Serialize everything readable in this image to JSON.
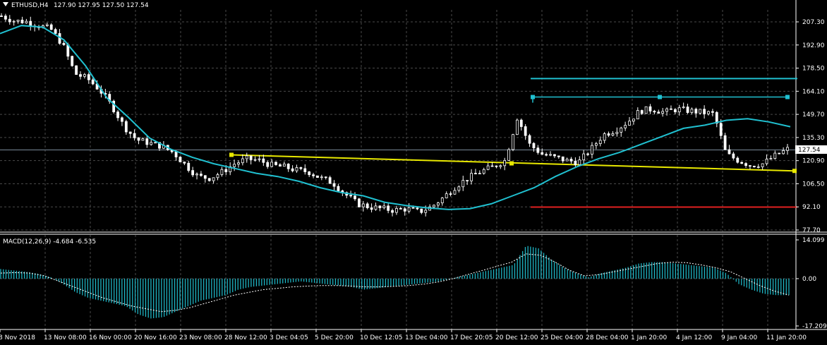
{
  "header": {
    "symbol": "ETHUSD,H4",
    "ohlc": "127.90 127.95 127.50 127.54"
  },
  "macd_header": {
    "label": "MACD(12,26,9) -4.684 -6.535"
  },
  "price_axis": {
    "ticks": [
      "207.30",
      "192.90",
      "178.50",
      "164.10",
      "149.70",
      "135.30",
      "120.90",
      "106.50",
      "92.10",
      "77.70"
    ],
    "current_price": "127.54"
  },
  "macd_axis": {
    "ticks": [
      "14.099",
      "0.00",
      "-17.209"
    ]
  },
  "time_axis": {
    "labels": [
      "8 Nov 2018",
      "13 Nov 08:00",
      "16 Nov 00:00",
      "20 Nov 16:00",
      "23 Nov 08:00",
      "28 Nov 12:00",
      "3 Dec 04:05",
      "5 Dec 20:00",
      "10 Dec 12:05",
      "13 Dec 04:00",
      "17 Dec 20:05",
      "20 Dec 12:00",
      "25 Dec 04:00",
      "28 Dec 04:00",
      "1 Jan 20:00",
      "4 Jan 12:00",
      "9 Jan 04:00",
      "11 Jan 20:00"
    ]
  },
  "colors": {
    "background": "#000000",
    "grid": "#4a4a4a",
    "candle": "#ffffff",
    "ma": "#20c0d0",
    "trendline": "#e8e800",
    "resistance": "#20c0d0",
    "support": "#e02020",
    "macd_hist": "#20c0d0",
    "macd_signal": "#ffffff",
    "current_price_line": "#7a8a99"
  },
  "chart_data": [
    {
      "type": "candlestick",
      "title": "ETHUSD,H4",
      "ylim": [
        77.7,
        216
      ],
      "x_labels": [
        "8 Nov 2018",
        "13 Nov 08:00",
        "16 Nov 00:00",
        "20 Nov 16:00",
        "23 Nov 08:00",
        "28 Nov 12:00",
        "3 Dec 04:05",
        "5 Dec 20:00",
        "10 Dec 12:05",
        "13 Dec 04:00",
        "17 Dec 20:05",
        "20 Dec 12:00",
        "25 Dec 04:00",
        "28 Dec 04:00",
        "1 Jan 20:00",
        "4 Jan 12:00",
        "9 Jan 04:00",
        "11 Jan 20:00"
      ],
      "close_path": [
        211,
        208,
        207.5,
        205,
        203,
        193,
        175,
        172,
        165,
        155,
        142,
        134,
        132,
        130,
        126,
        118,
        111,
        110,
        114,
        119,
        122,
        121,
        118,
        117,
        115,
        114,
        110,
        107,
        100,
        94,
        92,
        91,
        90,
        91,
        89,
        92,
        98,
        105,
        110,
        114,
        117,
        121,
        148,
        131,
        125,
        123,
        121,
        120,
        128,
        137,
        140,
        145,
        152,
        153,
        151,
        153,
        152,
        151,
        150,
        125,
        121,
        118,
        119,
        124,
        128
      ],
      "series": [
        {
          "name": "MA",
          "values": [
            200,
            205,
            204,
            196,
            180,
            160,
            148,
            135,
            128,
            123,
            119,
            116,
            113,
            111,
            108,
            104,
            101,
            99,
            95,
            93,
            91.5,
            90.5,
            91,
            94,
            99,
            104,
            111,
            117,
            122,
            126,
            131,
            136,
            141,
            143,
            146,
            147,
            145,
            142
          ]
        }
      ],
      "levels": {
        "resistance_upper": 172,
        "resistance": 160.5,
        "support": 92,
        "trendline_start": 124.5,
        "trendline_end": 114.5
      }
    },
    {
      "type": "bar",
      "title": "MACD(12,26,9) -4.684 -6.535",
      "ylim": [
        -17.209,
        14.099
      ],
      "series": [
        {
          "name": "histogram",
          "values": [
            3.5,
            3,
            2.5,
            1.8,
            0.5,
            -2,
            -5,
            -7,
            -8,
            -9,
            -10,
            -13,
            -14.5,
            -14,
            -12,
            -10,
            -8,
            -7,
            -6,
            -4,
            -3,
            -2.5,
            -2,
            -1.5,
            -1,
            -1.5,
            -2,
            -2.5,
            -3,
            -4,
            -3.5,
            -3,
            -2.5,
            -2,
            -1.5,
            -1,
            0,
            1,
            2,
            3,
            4,
            5,
            12,
            11,
            7,
            4,
            2,
            0.5,
            2,
            3,
            4,
            5.5,
            6,
            6,
            5.5,
            5,
            4.5,
            4,
            2,
            -2,
            -4,
            -5.5,
            -6,
            -6
          ]
        },
        {
          "name": "signal",
          "values": [
            2,
            2.2,
            2,
            1,
            -1,
            -3,
            -5,
            -7,
            -8.5,
            -10,
            -11,
            -12,
            -11.5,
            -10.5,
            -9,
            -7.5,
            -6,
            -5,
            -4,
            -3.5,
            -3,
            -2.7,
            -2.5,
            -2.5,
            -2.7,
            -3,
            -3,
            -2.8,
            -2.5,
            -2,
            -1.2,
            0,
            1.5,
            3,
            4.5,
            6,
            9,
            8.5,
            6,
            3,
            1,
            1.5,
            2.5,
            3.5,
            4.5,
            5.5,
            6,
            5.8,
            5,
            4,
            2.5,
            0,
            -2.5,
            -4.5,
            -6
          ]
        }
      ]
    }
  ]
}
